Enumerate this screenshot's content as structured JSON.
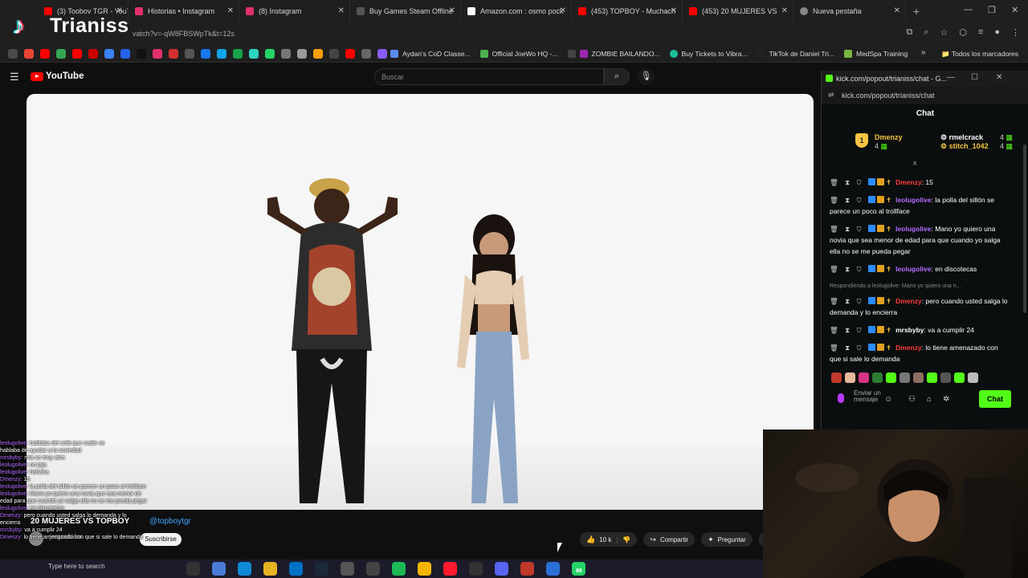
{
  "browser": {
    "tabs": [
      {
        "label": "(3) Toobov TGR - YouTu",
        "color": "#ff0000"
      },
      {
        "label": "Historias • Instagram",
        "color": "#e1306c"
      },
      {
        "label": "(8) Instagram",
        "color": "#e1306c"
      },
      {
        "label": "Buy Games Steam Offline",
        "color": "#555555"
      },
      {
        "label": "Amazon.com : osmo pock",
        "color": "#ffffff"
      },
      {
        "label": "(453) TOPBOY - Muchach",
        "color": "#ff0000"
      },
      {
        "label": "(453) 20 MUJERES VS",
        "color": "#ff0000"
      },
      {
        "label": "Nueva pestaña",
        "color": "#888888"
      }
    ],
    "url_fragment": "vatch?v=-qW8FBSWpTk&t=12s",
    "bookmarks": [
      {
        "label": "Aydan's CoD Classe...",
        "color": "#5b8def"
      },
      {
        "label": "Official JoeWo HQ -...",
        "color": "#4caf50"
      },
      {
        "label": "ZOMBIE BAILANDO...",
        "color": "#9c27b0"
      },
      {
        "label": "Buy Tickets to Vibra...",
        "color": "#1abc9c"
      },
      {
        "label": "TikTok de Daniel Tri...",
        "color": "#222222"
      },
      {
        "label": "MedSpa Training",
        "color": "#7cb342"
      }
    ],
    "bookmarks_folder": "Todos los marcadores"
  },
  "overlay": {
    "name": "Trianiss"
  },
  "youtube": {
    "logo": "YouTube",
    "search_placeholder": "Buscar",
    "video_title": "20 MUJERES VS TOPBOY",
    "handle": "@topboytgr",
    "channel": "jorgenitalex",
    "subscribe": "Suscribirse",
    "likes": "10 k",
    "share": "Compartir",
    "ask": "Preguntar"
  },
  "kick": {
    "window_title": "kick.com/popout/trianiss/chat - G...",
    "url": "kick.com/popout/trianiss/chat",
    "header": "Chat",
    "leaderboard": [
      {
        "rank": "1",
        "name": "Dmenzy",
        "count": "4"
      },
      {
        "name": "rmelcrack",
        "count": "4"
      },
      {
        "name": "stitch_1042",
        "count": "4"
      }
    ],
    "messages": [
      {
        "user": "Dmenzy",
        "text": "15",
        "color": "red"
      },
      {
        "user": "leolugolive",
        "text": "la polla del sillón se parece un poco al trollface",
        "color": "purple"
      },
      {
        "user": "leolugolive",
        "text": "Mano yo quiero una novia que sea menor de edad para que cuando yo salga ella no se me pueda pegar",
        "color": "purple"
      },
      {
        "user": "leolugolive",
        "text": "en discotecas",
        "color": "purple"
      },
      {
        "user": "Dmenzy",
        "text": "pero cuando usted salga lo demanda y lo encierra",
        "color": "red",
        "reply": "Respondiendo a leolugolive: Mano yo quiero una n..."
      },
      {
        "user": "mrsbyby",
        "text": "va a cumplir 24",
        "color": "white"
      },
      {
        "user": "Dmenzy",
        "text": "lo tiene amenazado con que si sale lo demanda",
        "color": "red"
      }
    ],
    "input_placeholder": "Enviar un mensaje",
    "send": "Chat"
  },
  "overlay_chat": [
    {
      "user": "leolugolive:",
      "text": "hablaba del sofá que nadie ve"
    },
    {
      "user": "",
      "text": "hablaba de ayudar a la sociedad"
    },
    {
      "user": "mrsbyby:",
      "text": "mia se muy alce"
    },
    {
      "user": "leolugolive:",
      "text": "no jaja"
    },
    {
      "user": "leolugolive:",
      "text": "hahaha"
    },
    {
      "user": "Dmenzy:",
      "text": "15"
    },
    {
      "user": "leolugolive:",
      "text": "la polla del sillón se parece un poco al trollface"
    },
    {
      "user": "leolugolive:",
      "text": "Mano yo quiero una novia que sea menor de"
    },
    {
      "user": "",
      "text": "edad para que cuando yo salga ella no se me pueda pegar"
    },
    {
      "user": "leolugolive:",
      "text": "en discotecas"
    },
    {
      "user": "Dmenzy:",
      "text": "pero cuando usted salga lo demanda y lo"
    },
    {
      "user": "",
      "text": "encierra"
    },
    {
      "user": "mrsbyby:",
      "text": "va a cumplir 24"
    },
    {
      "user": "Dmenzy:",
      "text": "lo tiene amenazado con que si sale lo demanda"
    }
  ],
  "taskbar": {
    "search": "Type here to search",
    "badge": "86"
  }
}
